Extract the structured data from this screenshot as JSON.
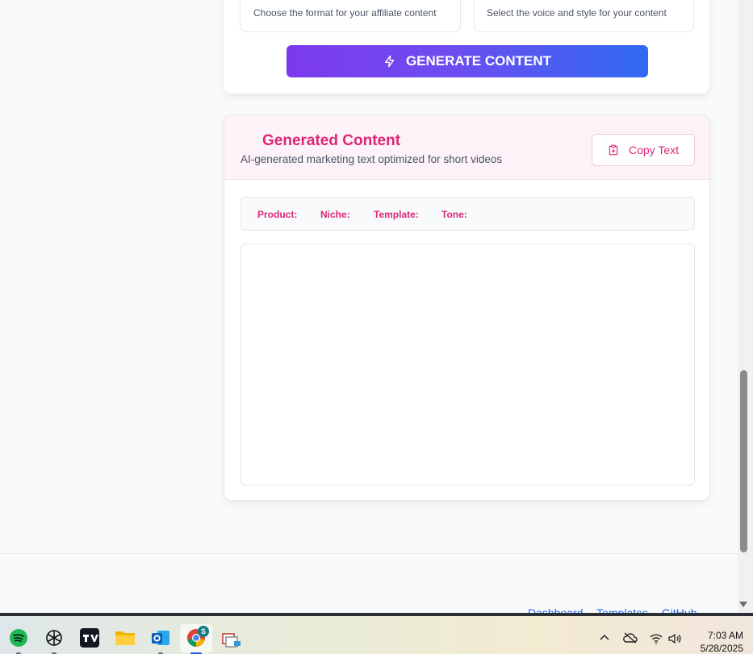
{
  "form": {
    "format_helper": "Choose the format for your affiliate content",
    "tone_helper": "Select the voice and style for your content",
    "generate_label": "GENERATE CONTENT",
    "generate_icon": "lightning-icon"
  },
  "output": {
    "title": "Generated Content",
    "subtitle": "AI-generated marketing text optimized for short videos",
    "copy_label": "Copy Text",
    "copy_icon": "clipboard-icon",
    "meta": {
      "product_label": "Product:",
      "niche_label": "Niche:",
      "template_label": "Template:",
      "tone_label": "Tone:"
    },
    "text": ""
  },
  "footer": {
    "links": [
      "Dashboard",
      "Templates",
      "GitHub"
    ]
  },
  "taskbar": {
    "apps": [
      "spotify-icon",
      "chatgpt-icon",
      "tradingview-icon",
      "file-explorer-icon",
      "outlook-icon",
      "chrome-icon",
      "stacked-windows-icon"
    ],
    "chrome_badge": "S",
    "time": "7:03 AM",
    "date": "5/28/2025"
  },
  "colors": {
    "accent_pink": "#db2777",
    "gradient_start": "#7c3aed",
    "gradient_end": "#2f6bf2",
    "link_blue": "#2563eb"
  }
}
